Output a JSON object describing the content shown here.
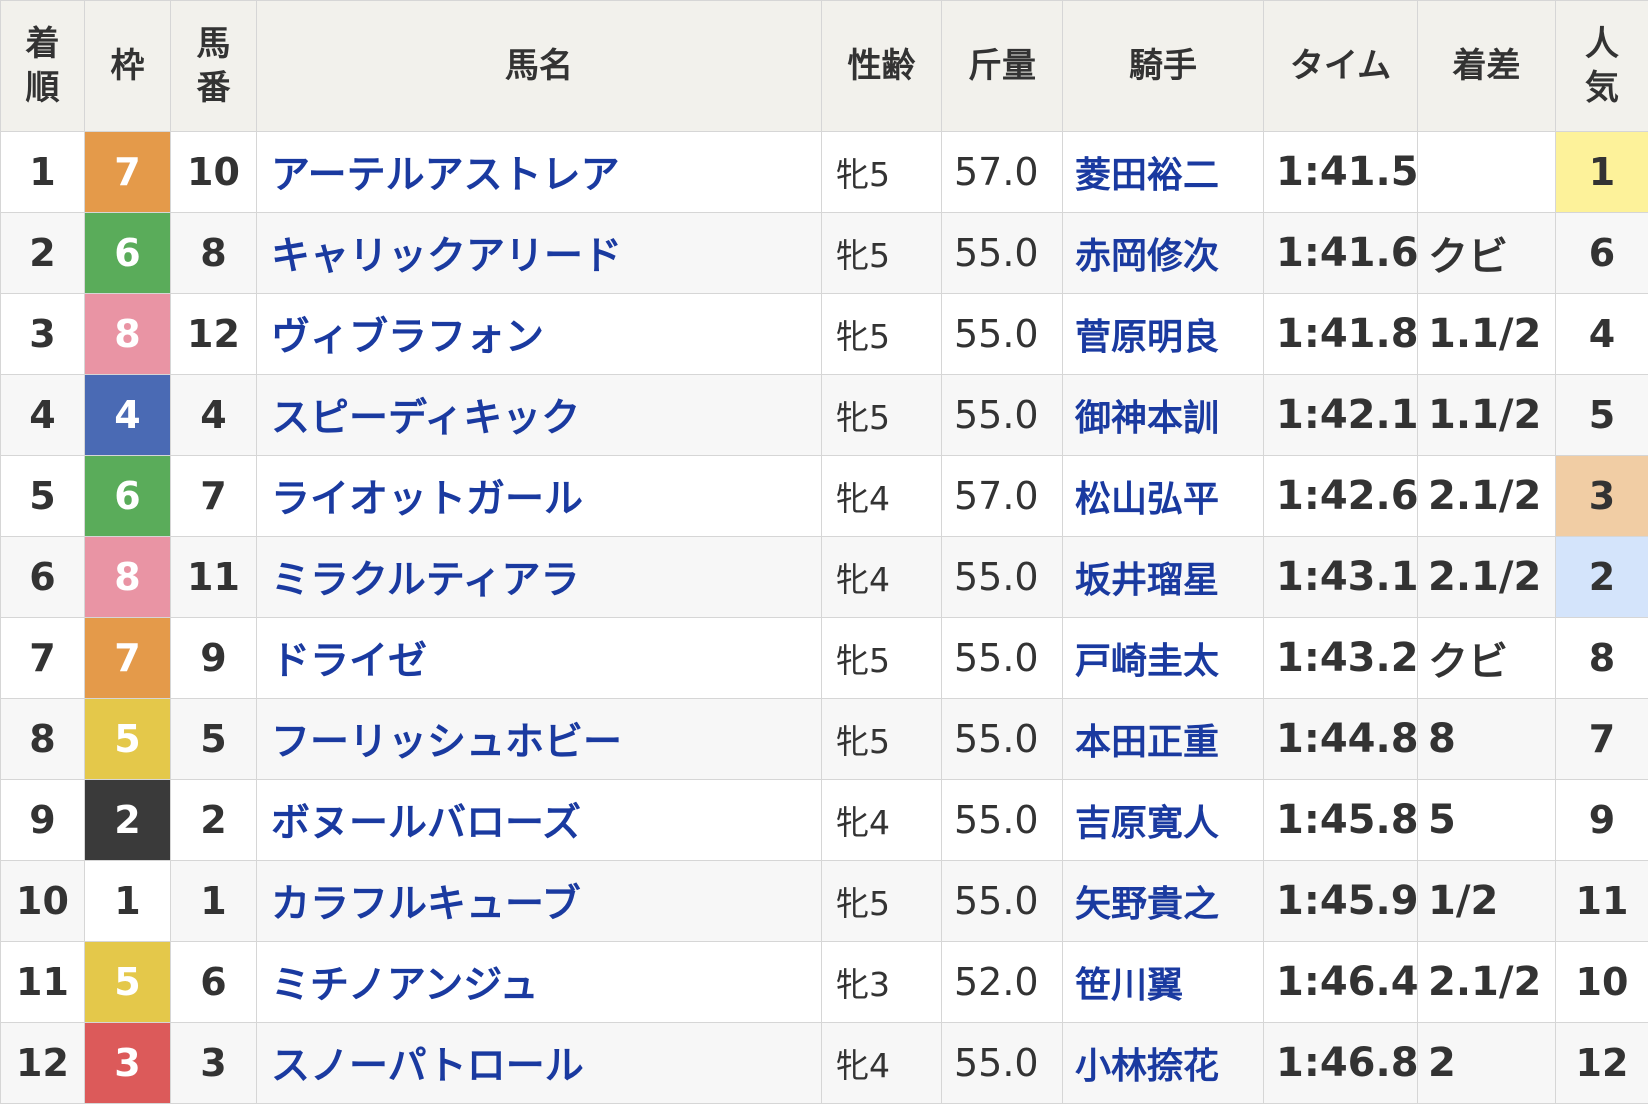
{
  "headers": {
    "rank_1": "着",
    "rank_2": "順",
    "frame": "枠",
    "number_1": "馬",
    "number_2": "番",
    "horse": "馬名",
    "sexage": "性齢",
    "weight": "斤量",
    "jockey": "騎手",
    "time": "タイム",
    "margin": "着差",
    "popularity_1": "人",
    "popularity_2": "気"
  },
  "colors": {
    "frame_1": "#ffffff",
    "frame_2": "#3a3a3a",
    "frame_3": "#dc5a5a",
    "frame_4": "#4a6ab4",
    "frame_5": "#e4c84a",
    "frame_6": "#5aac5a",
    "frame_7": "#e49a4a",
    "frame_8": "#e994a4",
    "pop_1": "#fdf29a",
    "pop_2": "#d4e4fb",
    "pop_3": "#f1cda4",
    "link": "#1a3aa0"
  },
  "rows": [
    {
      "rank": "1",
      "frame": "7",
      "num": "10",
      "horse": "アーテルアストレア",
      "sexage": "牝5",
      "weight": "57.0",
      "jockey": "菱田裕二",
      "time": "1:41.5",
      "margin": "",
      "pop": "1"
    },
    {
      "rank": "2",
      "frame": "6",
      "num": "8",
      "horse": "キャリックアリード",
      "sexage": "牝5",
      "weight": "55.0",
      "jockey": "赤岡修次",
      "time": "1:41.6",
      "margin": "クビ",
      "pop": "6"
    },
    {
      "rank": "3",
      "frame": "8",
      "num": "12",
      "horse": "ヴィブラフォン",
      "sexage": "牝5",
      "weight": "55.0",
      "jockey": "菅原明良",
      "time": "1:41.8",
      "margin": "1.1/2",
      "pop": "4"
    },
    {
      "rank": "4",
      "frame": "4",
      "num": "4",
      "horse": "スピーディキック",
      "sexage": "牝5",
      "weight": "55.0",
      "jockey": "御神本訓",
      "time": "1:42.1",
      "margin": "1.1/2",
      "pop": "5"
    },
    {
      "rank": "5",
      "frame": "6",
      "num": "7",
      "horse": "ライオットガール",
      "sexage": "牝4",
      "weight": "57.0",
      "jockey": "松山弘平",
      "time": "1:42.6",
      "margin": "2.1/2",
      "pop": "3"
    },
    {
      "rank": "6",
      "frame": "8",
      "num": "11",
      "horse": "ミラクルティアラ",
      "sexage": "牝4",
      "weight": "55.0",
      "jockey": "坂井瑠星",
      "time": "1:43.1",
      "margin": "2.1/2",
      "pop": "2"
    },
    {
      "rank": "7",
      "frame": "7",
      "num": "9",
      "horse": "ドライゼ",
      "sexage": "牝5",
      "weight": "55.0",
      "jockey": "戸崎圭太",
      "time": "1:43.2",
      "margin": "クビ",
      "pop": "8"
    },
    {
      "rank": "8",
      "frame": "5",
      "num": "5",
      "horse": "フーリッシュホビー",
      "sexage": "牝5",
      "weight": "55.0",
      "jockey": "本田正重",
      "time": "1:44.8",
      "margin": "8",
      "pop": "7"
    },
    {
      "rank": "9",
      "frame": "2",
      "num": "2",
      "horse": "ボヌールバローズ",
      "sexage": "牝4",
      "weight": "55.0",
      "jockey": "吉原寛人",
      "time": "1:45.8",
      "margin": "5",
      "pop": "9"
    },
    {
      "rank": "10",
      "frame": "1",
      "num": "1",
      "horse": "カラフルキューブ",
      "sexage": "牝5",
      "weight": "55.0",
      "jockey": "矢野貴之",
      "time": "1:45.9",
      "margin": "1/2",
      "pop": "11"
    },
    {
      "rank": "11",
      "frame": "5",
      "num": "6",
      "horse": "ミチノアンジュ",
      "sexage": "牝3",
      "weight": "52.0",
      "jockey": "笹川翼",
      "time": "1:46.4",
      "margin": "2.1/2",
      "pop": "10"
    },
    {
      "rank": "12",
      "frame": "3",
      "num": "3",
      "horse": "スノーパトロール",
      "sexage": "牝4",
      "weight": "55.0",
      "jockey": "小林捺花",
      "time": "1:46.8",
      "margin": "2",
      "pop": "12"
    }
  ]
}
